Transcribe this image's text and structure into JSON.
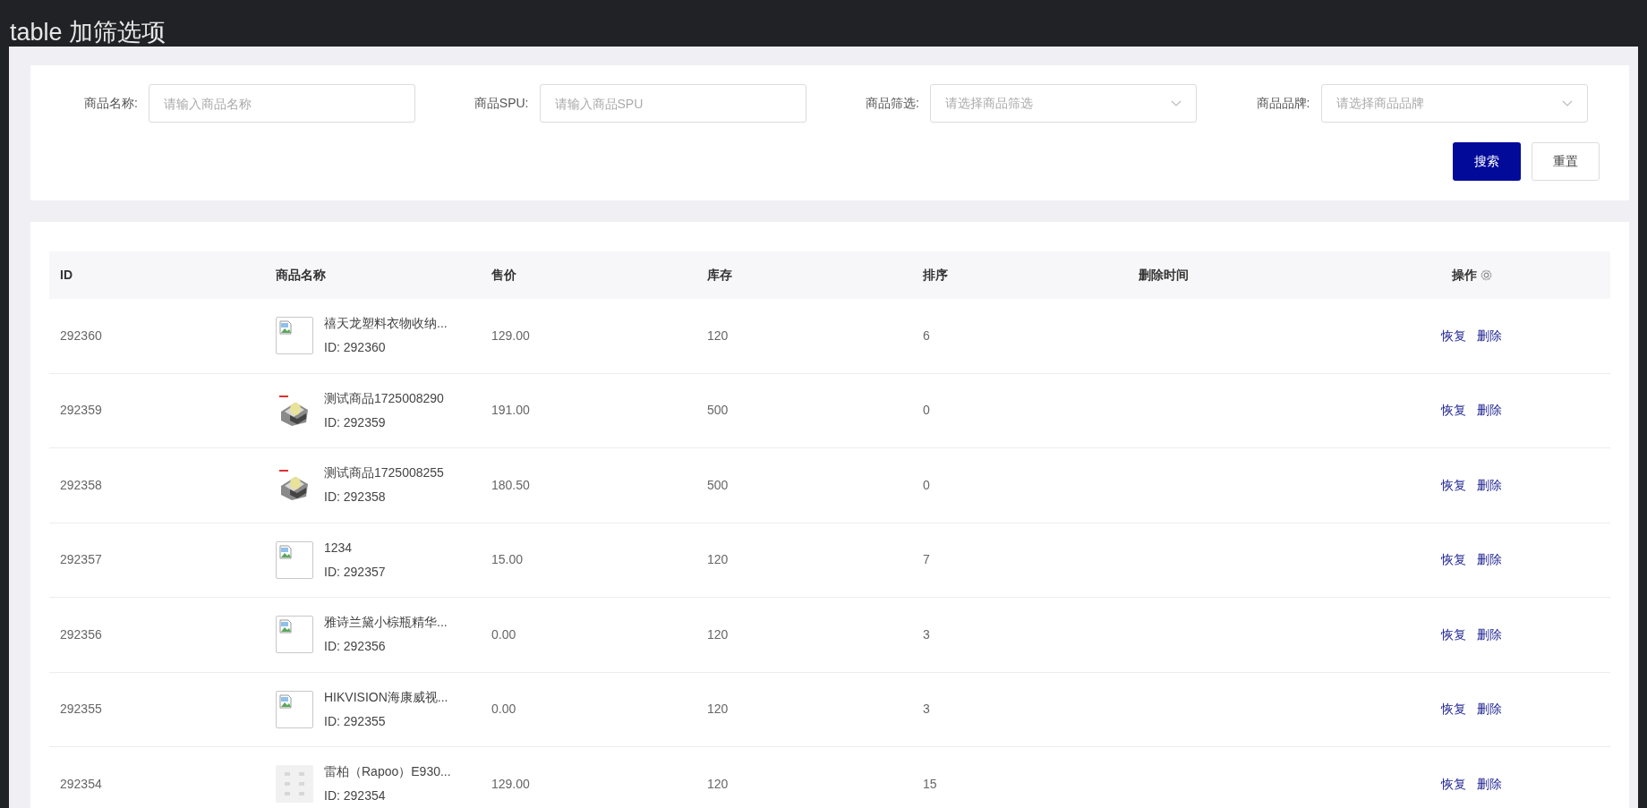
{
  "title": "table 加筛选项",
  "filters": [
    {
      "kind": "input",
      "label": "商品名称:",
      "placeholder": "请输入商品名称"
    },
    {
      "kind": "input",
      "label": "商品SPU:",
      "placeholder": "请输入商品SPU"
    },
    {
      "kind": "select",
      "label": "商品筛选:",
      "placeholder": "请选择商品筛选"
    },
    {
      "kind": "select",
      "label": "商品品牌:",
      "placeholder": "请选择商品品牌"
    }
  ],
  "buttons": [
    {
      "label": "搜索",
      "kind": "primary"
    },
    {
      "label": "重置",
      "kind": "default"
    }
  ],
  "table": {
    "columns": [
      "ID",
      "商品名称",
      "售价",
      "库存",
      "排序",
      "删除时间",
      "操作"
    ],
    "rows": [
      {
        "id": "292360",
        "name": "禧天龙塑料衣物收纳...",
        "sub": "ID: 292360",
        "kind": "broken",
        "price": "129.00",
        "stock": "120",
        "sort": "6",
        "actions": [
          "恢复",
          "删除"
        ]
      },
      {
        "id": "292359",
        "name": "测试商品1725008290",
        "sub": "ID: 292359",
        "price": "191.00",
        "stock": "500",
        "sort": "0",
        "actions": [
          "恢复",
          "删除"
        ]
      },
      {
        "id": "292358",
        "name": "测试商品1725008255",
        "sub": "ID: 292358",
        "price": "180.50",
        "stock": "500",
        "sort": "0",
        "actions": [
          "恢复",
          "删除"
        ]
      },
      {
        "id": "292357",
        "name": "1234",
        "sub": "ID: 292357",
        "kind": "broken",
        "price": "15.00",
        "stock": "120",
        "sort": "7",
        "actions": [
          "恢复",
          "删除"
        ]
      },
      {
        "id": "292356",
        "name": "雅诗兰黛小棕瓶精华...",
        "sub": "ID: 292356",
        "kind": "broken",
        "price": "0.00",
        "stock": "120",
        "sort": "3",
        "actions": [
          "恢复",
          "删除"
        ]
      },
      {
        "id": "292355",
        "name": "HIKVISION海康威视...",
        "sub": "ID: 292355",
        "kind": "broken",
        "price": "0.00",
        "stock": "120",
        "sort": "3",
        "actions": [
          "恢复",
          "删除"
        ]
      },
      {
        "id": "292354",
        "name": "雷柏（Rapoo）E930...",
        "sub": "ID: 292354",
        "kind": "pale",
        "price": "129.00",
        "stock": "120",
        "sort": "15",
        "actions": [
          "恢复",
          "删除"
        ]
      }
    ]
  }
}
